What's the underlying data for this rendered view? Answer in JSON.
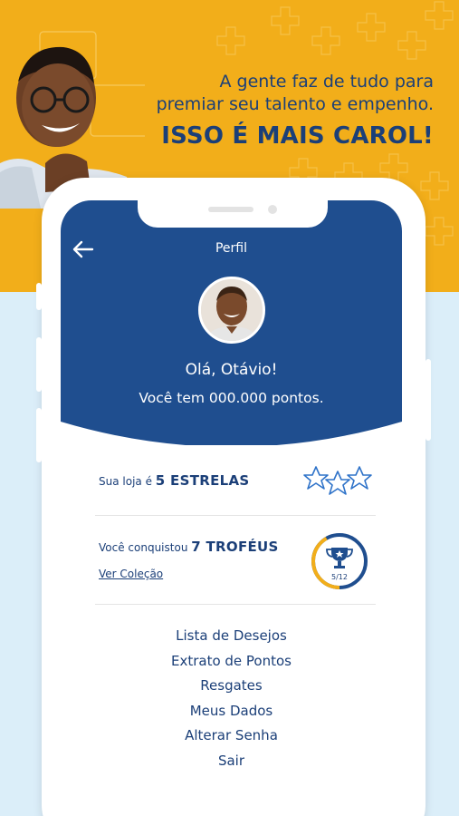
{
  "banner": {
    "tagline_line1": "A gente faz de tudo para",
    "tagline_line2": "premiar seu talento e empenho.",
    "tagline_strong": "ISSO É MAIS CAROL!",
    "background_color": "#f2ae1a",
    "text_color": "#1b3f78"
  },
  "header": {
    "title": "Perfil",
    "back_icon": "arrow-left-icon",
    "greeting": "Olá, Otávio!",
    "points_text": "Você tem 000.000 pontos.",
    "background_color": "#1f4e8f"
  },
  "stars_row": {
    "label_prefix": "Sua loja é",
    "label_value": "5 ESTRELAS",
    "icon": "stars-icon"
  },
  "trophies_row": {
    "label_prefix": "Você conquistou",
    "label_value": "7 TROFÉUS",
    "link": "Ver Coleção",
    "progress_label": "5/12",
    "progress_fraction": 0.4167,
    "icon": "trophy-icon",
    "progress_color": "#f2ae1a",
    "track_color": "#1f4e8f"
  },
  "menu": {
    "items": [
      {
        "label": "Lista de Desejos"
      },
      {
        "label": "Extrato de Pontos"
      },
      {
        "label": "Resgates"
      },
      {
        "label": "Meus Dados"
      },
      {
        "label": "Alterar Senha"
      },
      {
        "label": "Sair"
      }
    ]
  }
}
